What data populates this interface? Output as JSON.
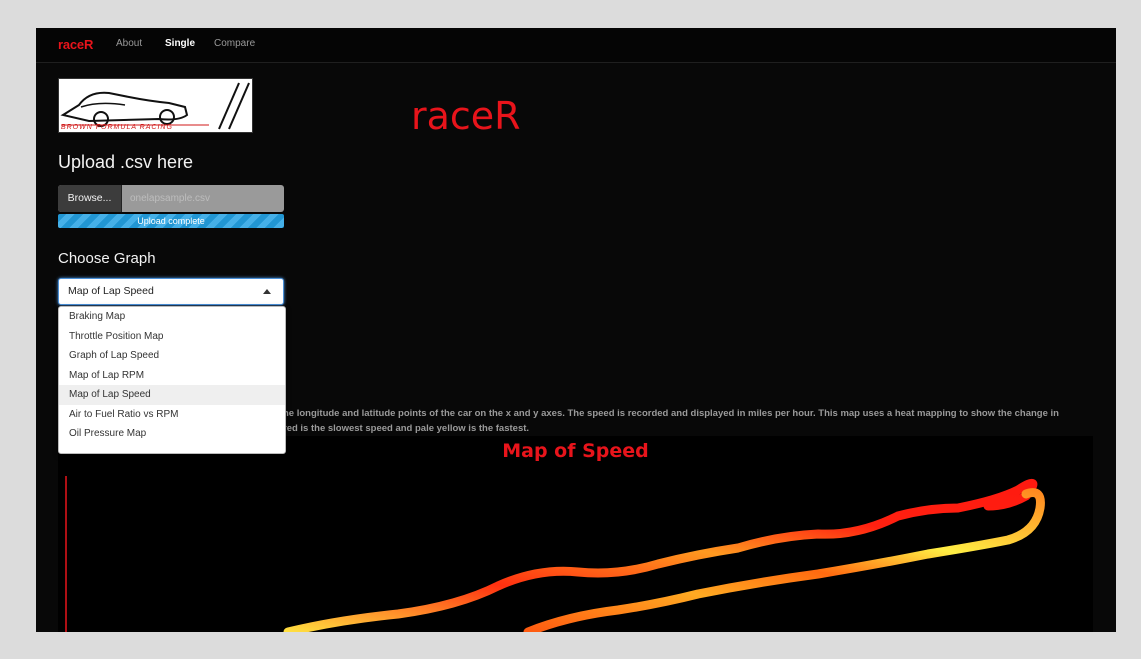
{
  "navbar": {
    "brand": "raceR",
    "links": [
      "About",
      "Single",
      "Compare"
    ],
    "active": "Single"
  },
  "logo": {
    "text": "BROWN FORMULA RACING"
  },
  "hero_title": "raceR",
  "upload": {
    "title": "Upload .csv here",
    "browse_label": "Browse...",
    "file_name": "onelapsample.csv",
    "progress_label": "Upload complete",
    "progress": 1.0
  },
  "graph_select": {
    "title": "Choose Graph",
    "selected": "Map of Lap Speed",
    "options": [
      "Braking Map",
      "Throttle Position Map",
      "Graph of Lap Speed",
      "Map of Lap RPM",
      "Map of Lap Speed",
      "Air to Fuel Ratio vs RPM",
      "Oil Pressure Map"
    ]
  },
  "description": {
    "line1": "he longitude and latitude points of the car on the x and y axes. The speed is recorded and displayed in miles per hour. This map uses a heat mapping to show the change in",
    "line2": "red is the slowest speed and pale yellow is the fastest."
  },
  "chart": {
    "title": "Map of Speed",
    "colors": {
      "slow": "#ee1111",
      "mid": "#ff7a10",
      "fast": "#ffff55"
    }
  },
  "theme": {
    "accent": "#e8141b",
    "background": "#080808"
  }
}
